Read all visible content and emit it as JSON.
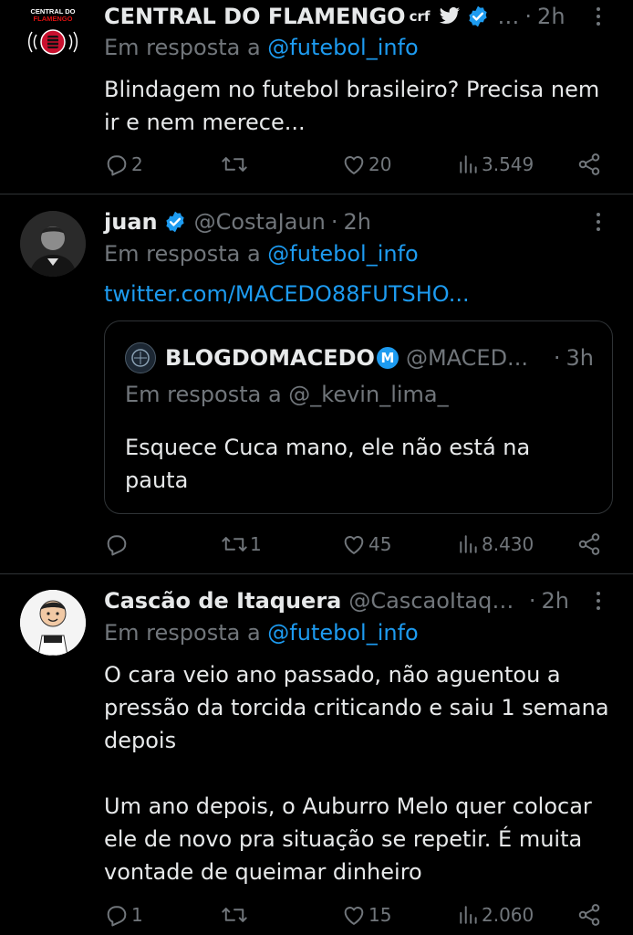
{
  "tweets": [
    {
      "name": "CENTRAL DO FLAMENGO",
      "name_suffix": "crf",
      "handle": "…",
      "time": "2h",
      "reply_prefix": "Em resposta a",
      "reply_to": "@futebol_info",
      "text": "Blindagem no futebol brasileiro? Precisa nem ir e nem merece...",
      "avatar_text": [
        "CENTRAL DO",
        "FLAMENGO"
      ],
      "replies": "2",
      "retweets": "",
      "likes": "20",
      "views": "3.549"
    },
    {
      "name": "juan",
      "handle": "@CostaJaun",
      "time": "2h",
      "reply_prefix": "Em resposta a",
      "reply_to": "@futebol_info",
      "link": "twitter.com/MACEDO88FUTSHO...",
      "quote": {
        "name": "BLOGDOMACEDO",
        "badge": "M",
        "handle": "@MACED...",
        "time": "3h",
        "reply_prefix": "Em resposta a",
        "reply_to": "@_kevin_lima_",
        "text": "Esquece Cuca mano, ele não está na pauta"
      },
      "replies": "",
      "retweets": "1",
      "likes": "45",
      "views": "8.430"
    },
    {
      "name": "Cascão de Itaquera",
      "handle": "@CascaoItaqu...",
      "time": "2h",
      "reply_prefix": "Em resposta a",
      "reply_to": "@futebol_info",
      "text_p1": "O cara veio ano passado, não aguentou a pressão da torcida criticando e saiu 1 semana depois",
      "text_p2": "Um ano depois, o Auburro Melo quer colocar ele de novo pra situação se repetir. É muita vontade de queimar dinheiro",
      "replies": "1",
      "retweets": "",
      "likes": "15",
      "views": "2.060"
    }
  ],
  "colors": {
    "background": "#000000",
    "text": "#e7e9ea",
    "muted": "#71767b",
    "accent": "#1d9bf0",
    "divider": "#2f3336"
  }
}
